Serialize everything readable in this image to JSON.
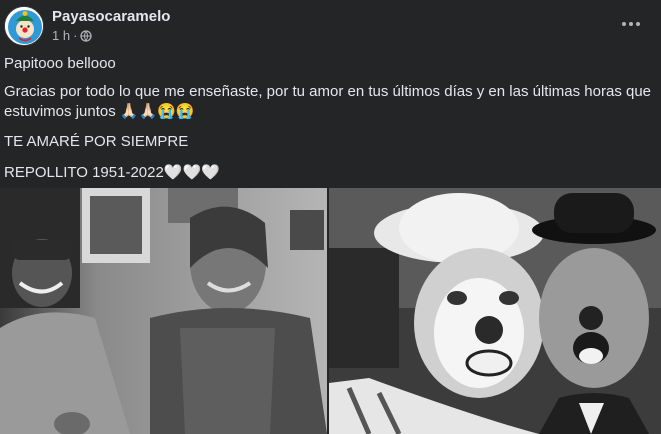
{
  "post": {
    "page_name": "Payasocaramelo",
    "timestamp": "1 h",
    "separator": "·",
    "paragraphs": [
      "Papitooo bellooo",
      "Gracias por todo lo que me enseñaste, por tu amor en tus últimos días y en las últimas horas que estuvimos juntos 🙏🏻🙏🏻😭😭",
      "TE AMARÉ POR SIEMPRE",
      "REPOLLITO 1951-2022🤍🤍🤍"
    ],
    "icons": {
      "avatar": "clown-avatar-icon",
      "privacy": "globe-icon",
      "menu": "more-options-icon"
    }
  },
  "photos": [
    {
      "name": "photo-two-men-smiling"
    },
    {
      "name": "photo-two-clowns"
    }
  ],
  "colors": {
    "background": "#242526",
    "text_primary": "#e4e6eb",
    "text_secondary": "#b0b3b8"
  }
}
